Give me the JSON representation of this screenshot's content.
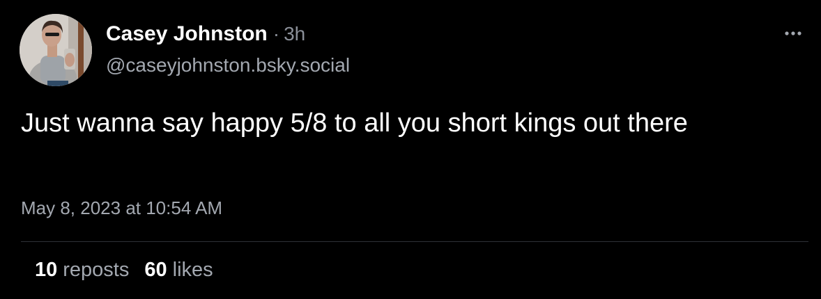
{
  "post": {
    "author": {
      "display_name": "Casey Johnston",
      "handle": "@caseyjohnston.bsky.social",
      "time_ago": "3h",
      "separator": "·"
    },
    "text": "Just wanna say happy 5/8 to all you short kings out there",
    "timestamp": "May 8, 2023 at 10:54 AM",
    "stats": {
      "reposts_count": "10",
      "reposts_label": "reposts",
      "likes_count": "60",
      "likes_label": "likes"
    },
    "more_icon": "ellipsis-horizontal-icon"
  },
  "colors": {
    "background": "#000000",
    "primary_text": "#ffffff",
    "secondary_text": "#a3a8b0",
    "divider": "#2e3238"
  }
}
